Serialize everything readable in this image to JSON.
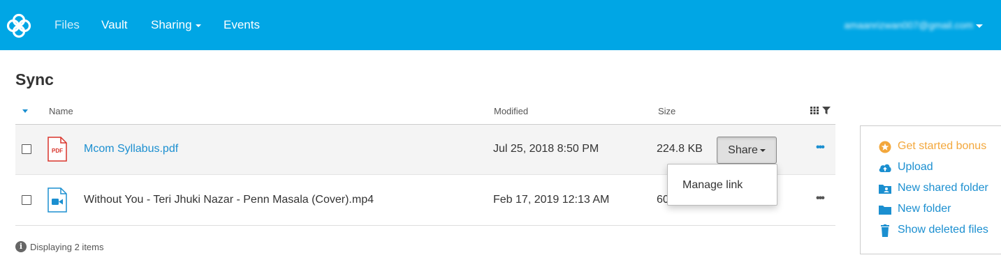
{
  "nav": {
    "items": [
      "Files",
      "Vault",
      "Sharing",
      "Events"
    ],
    "account": "amaanrizwan007@gmail.com"
  },
  "page": {
    "title": "Sync"
  },
  "table": {
    "columns": [
      "Name",
      "Modified",
      "Size"
    ],
    "rows": [
      {
        "name": "Mcom Syllabus.pdf",
        "modified": "Jul 25, 2018 8:50 PM",
        "size": "224.8 KB",
        "icon": "pdf-icon"
      },
      {
        "name": "Without You - Teri Jhuki Nazar - Penn Masala (Cover).mp4",
        "modified": "Feb 17, 2019 12:13 AM",
        "size": "60",
        "icon": "video-file-icon"
      }
    ],
    "share_label": "Share",
    "more_label": "•••",
    "dropdown": {
      "items": [
        "Manage link"
      ]
    }
  },
  "footer": {
    "info_glyph": "i",
    "text": "Displaying 2 items"
  },
  "side_panel": {
    "items": [
      {
        "label": "Get started bonus",
        "icon": "star-icon"
      },
      {
        "label": "Upload",
        "icon": "cloud-upload-icon"
      },
      {
        "label": "New shared folder",
        "icon": "shared-folder-icon"
      },
      {
        "label": "New folder",
        "icon": "folder-icon"
      },
      {
        "label": "Show deleted files",
        "icon": "trash-icon"
      }
    ]
  },
  "colors": {
    "brand": "#00a6e5",
    "link": "#1b8fd0",
    "bonus": "#f3a73b"
  }
}
